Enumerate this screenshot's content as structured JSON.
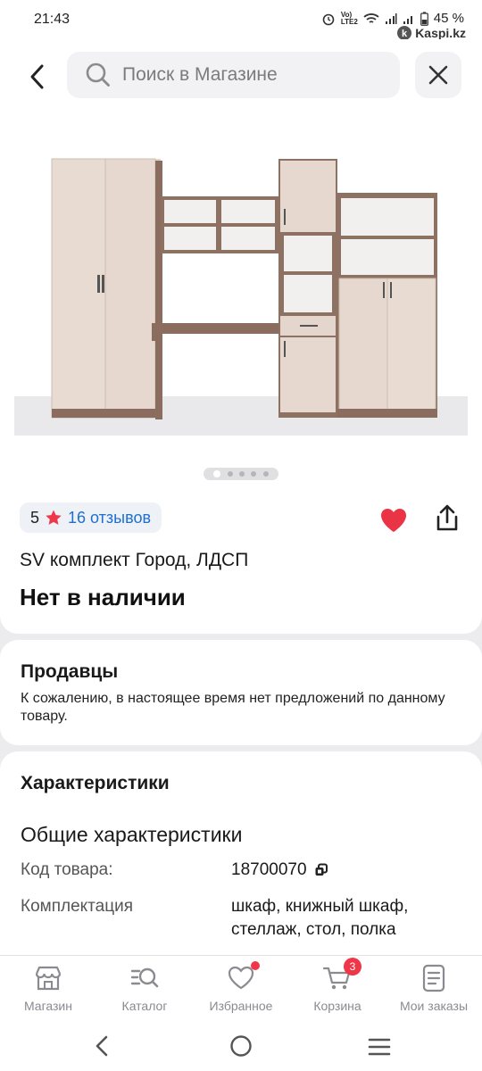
{
  "status": {
    "time": "21:43",
    "battery": "45 %",
    "brand": "Kaspi.kz"
  },
  "search": {
    "placeholder": "Поиск в Магазине"
  },
  "product": {
    "rating": "5",
    "reviews": "16 отзывов",
    "title": "SV комплект Город, ЛДСП",
    "availability": "Нет в наличии",
    "image_count": 5,
    "active_image": 1
  },
  "sellers": {
    "heading": "Продавцы",
    "message": "К сожалению, в настоящее время нет предложений по данному товару."
  },
  "specs": {
    "heading": "Характеристики",
    "group": "Общие характеристики",
    "rows": [
      {
        "key": "Код товара:",
        "value": "18700070"
      },
      {
        "key": "Комплектация",
        "value": "шкаф, книжный шкаф, стеллаж, стол, полка"
      }
    ]
  },
  "nav": {
    "items": [
      {
        "label": "Магазин",
        "icon": "store-icon"
      },
      {
        "label": "Каталог",
        "icon": "catalog-search-icon"
      },
      {
        "label": "Избранное",
        "icon": "heart-icon"
      },
      {
        "label": "Корзина",
        "icon": "cart-icon",
        "badge": "3"
      },
      {
        "label": "Мои заказы",
        "icon": "orders-icon"
      }
    ]
  },
  "colors": {
    "accent_red": "#f0374a",
    "link_blue": "#1f6fd0",
    "heart_red": "#ea3344"
  }
}
